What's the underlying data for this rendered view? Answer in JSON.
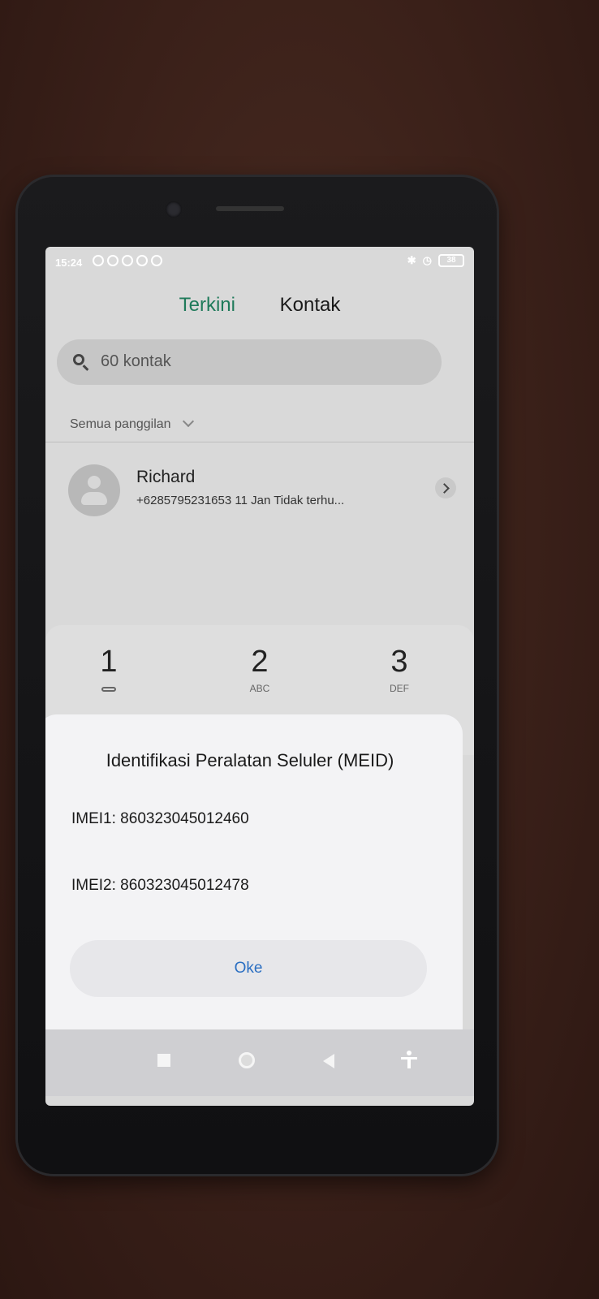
{
  "status_bar": {
    "time": "15:24",
    "battery": "38"
  },
  "tabs": {
    "recent": "Terkini",
    "contacts": "Kontak"
  },
  "search": {
    "placeholder": "60 kontak"
  },
  "filter": {
    "label": "Semua panggilan"
  },
  "call_log": [
    {
      "name": "Richard",
      "detail": "+6285795231653  11 Jan Tidak terhu..."
    }
  ],
  "keypad": [
    {
      "digit": "1",
      "letters": ""
    },
    {
      "digit": "2",
      "letters": "ABC"
    },
    {
      "digit": "3",
      "letters": "DEF"
    }
  ],
  "dialog": {
    "title": "Identifikasi Peralatan Seluler (MEID)",
    "imei1": "IMEI1: 860323045012460",
    "imei2": "IMEI2: 860323045012478",
    "ok_label": "Oke"
  }
}
